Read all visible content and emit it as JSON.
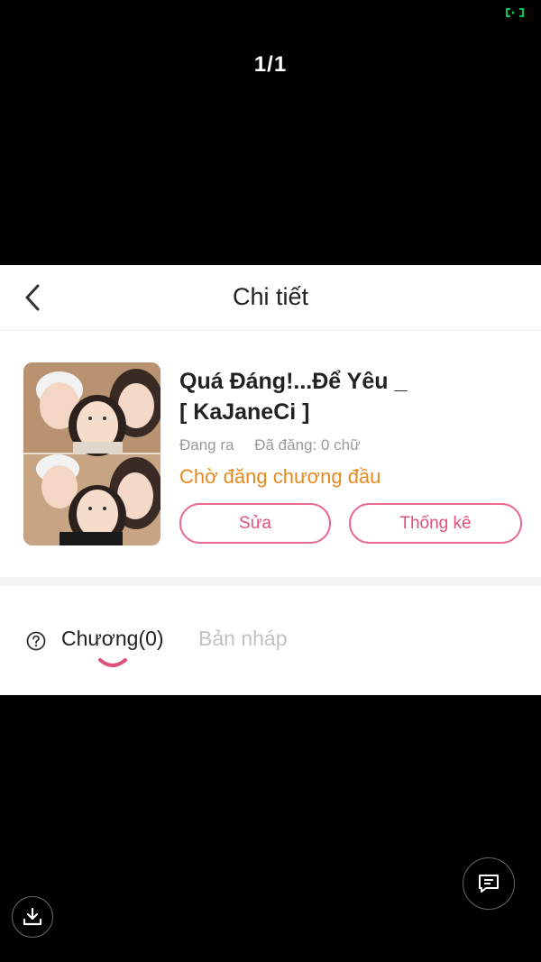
{
  "viewer": {
    "page_counter": "1/1",
    "fullscreen_icon": "fullscreen-icon",
    "accent_color": "#00c853"
  },
  "nav": {
    "title": "Chi tiết",
    "back_icon": "chevron-left-icon"
  },
  "book": {
    "title_line1": "Quá Đáng!...Để Yêu _",
    "title_line2": "[ KaJaneCi ]",
    "status": "Đang ra",
    "published": "Đã đăng: 0 chữ",
    "notice": "Chờ đăng chương đầu",
    "notice_color": "#e68a1f",
    "cover": "photo-collage"
  },
  "actions": {
    "edit_label": "Sửa",
    "stats_label": "Thống kê",
    "accent_color": "#e0517a"
  },
  "tabs": {
    "help_icon": "question-circle-icon",
    "chapters_label": "Chương(0)",
    "drafts_label": "Bản nháp",
    "active": "chapters"
  },
  "floating": {
    "comment_icon": "comment-icon",
    "download_icon": "download-icon"
  }
}
